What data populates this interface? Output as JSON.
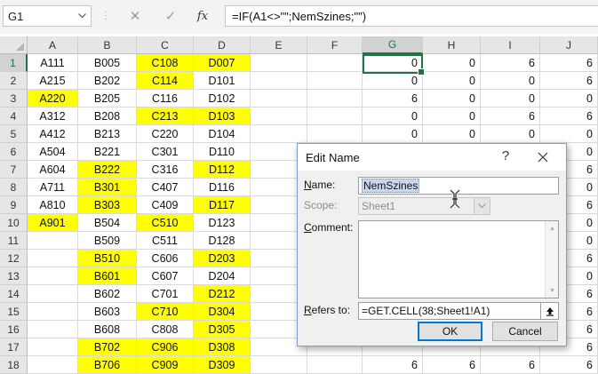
{
  "formula_bar": {
    "name_box": "G1",
    "cancel_icon": "✕",
    "enter_icon": "✓",
    "fx_label": "fx",
    "formula": "=IF(A1<>\"\";NemSzines;\"\")"
  },
  "columns": [
    "A",
    "B",
    "C",
    "D",
    "E",
    "F",
    "G",
    "H",
    "I",
    "J"
  ],
  "selected_column": "G",
  "selected_row": "1",
  "rows": [
    {
      "n": "1",
      "cells": [
        {
          "v": "A111",
          "y": false
        },
        {
          "v": "B005",
          "y": false
        },
        {
          "v": "C108",
          "y": true
        },
        {
          "v": "D007",
          "y": true
        },
        {
          "v": "",
          "y": false
        },
        {
          "v": "",
          "y": false
        },
        {
          "v": "0",
          "y": false
        },
        {
          "v": "0",
          "y": false
        },
        {
          "v": "6",
          "y": false
        },
        {
          "v": "6",
          "y": false
        }
      ]
    },
    {
      "n": "2",
      "cells": [
        {
          "v": "A215",
          "y": false
        },
        {
          "v": "B202",
          "y": false
        },
        {
          "v": "C114",
          "y": true
        },
        {
          "v": "D101",
          "y": false
        },
        {
          "v": "",
          "y": false
        },
        {
          "v": "",
          "y": false
        },
        {
          "v": "0",
          "y": false
        },
        {
          "v": "0",
          "y": false
        },
        {
          "v": "0",
          "y": false
        },
        {
          "v": "6",
          "y": false
        }
      ]
    },
    {
      "n": "3",
      "cells": [
        {
          "v": "A220",
          "y": true
        },
        {
          "v": "B205",
          "y": false
        },
        {
          "v": "C116",
          "y": false
        },
        {
          "v": "D102",
          "y": false
        },
        {
          "v": "",
          "y": false
        },
        {
          "v": "",
          "y": false
        },
        {
          "v": "6",
          "y": false
        },
        {
          "v": "0",
          "y": false
        },
        {
          "v": "0",
          "y": false
        },
        {
          "v": "0",
          "y": false
        }
      ]
    },
    {
      "n": "4",
      "cells": [
        {
          "v": "A312",
          "y": false
        },
        {
          "v": "B208",
          "y": false
        },
        {
          "v": "C213",
          "y": true
        },
        {
          "v": "D103",
          "y": true
        },
        {
          "v": "",
          "y": false
        },
        {
          "v": "",
          "y": false
        },
        {
          "v": "0",
          "y": false
        },
        {
          "v": "0",
          "y": false
        },
        {
          "v": "6",
          "y": false
        },
        {
          "v": "6",
          "y": false
        }
      ]
    },
    {
      "n": "5",
      "cells": [
        {
          "v": "A412",
          "y": false
        },
        {
          "v": "B213",
          "y": false
        },
        {
          "v": "C220",
          "y": false
        },
        {
          "v": "D104",
          "y": false
        },
        {
          "v": "",
          "y": false
        },
        {
          "v": "",
          "y": false
        },
        {
          "v": "0",
          "y": false
        },
        {
          "v": "0",
          "y": false
        },
        {
          "v": "0",
          "y": false
        },
        {
          "v": "0",
          "y": false
        }
      ]
    },
    {
      "n": "6",
      "cells": [
        {
          "v": "A504",
          "y": false
        },
        {
          "v": "B221",
          "y": false
        },
        {
          "v": "C301",
          "y": false
        },
        {
          "v": "D110",
          "y": false
        },
        {
          "v": "",
          "y": false
        },
        {
          "v": "",
          "y": false
        },
        {
          "v": "",
          "y": false
        },
        {
          "v": "",
          "y": false
        },
        {
          "v": "",
          "y": false
        },
        {
          "v": "0",
          "y": false
        }
      ]
    },
    {
      "n": "7",
      "cells": [
        {
          "v": "A604",
          "y": false
        },
        {
          "v": "B222",
          "y": true
        },
        {
          "v": "C316",
          "y": false
        },
        {
          "v": "D112",
          "y": true
        },
        {
          "v": "",
          "y": false
        },
        {
          "v": "",
          "y": false
        },
        {
          "v": "",
          "y": false
        },
        {
          "v": "",
          "y": false
        },
        {
          "v": "",
          "y": false
        },
        {
          "v": "6",
          "y": false
        }
      ]
    },
    {
      "n": "8",
      "cells": [
        {
          "v": "A711",
          "y": false
        },
        {
          "v": "B301",
          "y": true
        },
        {
          "v": "C407",
          "y": false
        },
        {
          "v": "D116",
          "y": false
        },
        {
          "v": "",
          "y": false
        },
        {
          "v": "",
          "y": false
        },
        {
          "v": "",
          "y": false
        },
        {
          "v": "",
          "y": false
        },
        {
          "v": "",
          "y": false
        },
        {
          "v": "0",
          "y": false
        }
      ]
    },
    {
      "n": "9",
      "cells": [
        {
          "v": "A810",
          "y": false
        },
        {
          "v": "B303",
          "y": true
        },
        {
          "v": "C409",
          "y": false
        },
        {
          "v": "D117",
          "y": true
        },
        {
          "v": "",
          "y": false
        },
        {
          "v": "",
          "y": false
        },
        {
          "v": "",
          "y": false
        },
        {
          "v": "",
          "y": false
        },
        {
          "v": "",
          "y": false
        },
        {
          "v": "6",
          "y": false
        }
      ]
    },
    {
      "n": "10",
      "cells": [
        {
          "v": "A901",
          "y": true
        },
        {
          "v": "B504",
          "y": false
        },
        {
          "v": "C510",
          "y": true
        },
        {
          "v": "D123",
          "y": false
        },
        {
          "v": "",
          "y": false
        },
        {
          "v": "",
          "y": false
        },
        {
          "v": "",
          "y": false
        },
        {
          "v": "",
          "y": false
        },
        {
          "v": "",
          "y": false
        },
        {
          "v": "0",
          "y": false
        }
      ]
    },
    {
      "n": "11",
      "cells": [
        {
          "v": "",
          "y": false
        },
        {
          "v": "B509",
          "y": false
        },
        {
          "v": "C511",
          "y": false
        },
        {
          "v": "D128",
          "y": false
        },
        {
          "v": "",
          "y": false
        },
        {
          "v": "",
          "y": false
        },
        {
          "v": "",
          "y": false
        },
        {
          "v": "",
          "y": false
        },
        {
          "v": "",
          "y": false
        },
        {
          "v": "0",
          "y": false
        }
      ]
    },
    {
      "n": "12",
      "cells": [
        {
          "v": "",
          "y": false
        },
        {
          "v": "B510",
          "y": true
        },
        {
          "v": "C606",
          "y": false
        },
        {
          "v": "D203",
          "y": true
        },
        {
          "v": "",
          "y": false
        },
        {
          "v": "",
          "y": false
        },
        {
          "v": "",
          "y": false
        },
        {
          "v": "",
          "y": false
        },
        {
          "v": "",
          "y": false
        },
        {
          "v": "6",
          "y": false
        }
      ]
    },
    {
      "n": "13",
      "cells": [
        {
          "v": "",
          "y": false
        },
        {
          "v": "B601",
          "y": true
        },
        {
          "v": "C607",
          "y": false
        },
        {
          "v": "D204",
          "y": false
        },
        {
          "v": "",
          "y": false
        },
        {
          "v": "",
          "y": false
        },
        {
          "v": "",
          "y": false
        },
        {
          "v": "",
          "y": false
        },
        {
          "v": "",
          "y": false
        },
        {
          "v": "0",
          "y": false
        }
      ]
    },
    {
      "n": "14",
      "cells": [
        {
          "v": "",
          "y": false
        },
        {
          "v": "B602",
          "y": false
        },
        {
          "v": "C701",
          "y": false
        },
        {
          "v": "D212",
          "y": true
        },
        {
          "v": "",
          "y": false
        },
        {
          "v": "",
          "y": false
        },
        {
          "v": "",
          "y": false
        },
        {
          "v": "",
          "y": false
        },
        {
          "v": "",
          "y": false
        },
        {
          "v": "6",
          "y": false
        }
      ]
    },
    {
      "n": "15",
      "cells": [
        {
          "v": "",
          "y": false
        },
        {
          "v": "B603",
          "y": false
        },
        {
          "v": "C710",
          "y": true
        },
        {
          "v": "D304",
          "y": true
        },
        {
          "v": "",
          "y": false
        },
        {
          "v": "",
          "y": false
        },
        {
          "v": "",
          "y": false
        },
        {
          "v": "",
          "y": false
        },
        {
          "v": "",
          "y": false
        },
        {
          "v": "6",
          "y": false
        }
      ]
    },
    {
      "n": "16",
      "cells": [
        {
          "v": "",
          "y": false
        },
        {
          "v": "B608",
          "y": false
        },
        {
          "v": "C808",
          "y": false
        },
        {
          "v": "D305",
          "y": true
        },
        {
          "v": "",
          "y": false
        },
        {
          "v": "",
          "y": false
        },
        {
          "v": "",
          "y": false
        },
        {
          "v": "",
          "y": false
        },
        {
          "v": "",
          "y": false
        },
        {
          "v": "6",
          "y": false
        }
      ]
    },
    {
      "n": "17",
      "cells": [
        {
          "v": "",
          "y": false
        },
        {
          "v": "B702",
          "y": true
        },
        {
          "v": "C906",
          "y": true
        },
        {
          "v": "D308",
          "y": true
        },
        {
          "v": "",
          "y": false
        },
        {
          "v": "",
          "y": false
        },
        {
          "v": "",
          "y": false
        },
        {
          "v": "",
          "y": false
        },
        {
          "v": "",
          "y": false
        },
        {
          "v": "6",
          "y": false
        }
      ]
    },
    {
      "n": "18",
      "cells": [
        {
          "v": "",
          "y": false
        },
        {
          "v": "B706",
          "y": true
        },
        {
          "v": "C909",
          "y": true
        },
        {
          "v": "D309",
          "y": true
        },
        {
          "v": "",
          "y": false
        },
        {
          "v": "",
          "y": false
        },
        {
          "v": "6",
          "y": false
        },
        {
          "v": "6",
          "y": false
        },
        {
          "v": "6",
          "y": false
        },
        {
          "v": "6",
          "y": false
        }
      ]
    }
  ],
  "dialog": {
    "title": "Edit Name",
    "help_glyph": "?",
    "close_glyph": "✕",
    "name_label_u": "N",
    "name_label_rest": "ame:",
    "name_value": "NemSzines",
    "scope_label": "Scope:",
    "scope_value": "Sheet1",
    "comment_label_u": "C",
    "comment_label_rest": "omment:",
    "comment_value": "",
    "refers_label_u": "R",
    "refers_label_rest": "efers to:",
    "refers_value": "=GET.CELL(38;Sheet1!A1)",
    "ok_label": "OK",
    "cancel_label": "Cancel"
  },
  "colors": {
    "highlight": "#ffff00",
    "selection": "#217346",
    "dialog_focus": "#0078d7"
  }
}
